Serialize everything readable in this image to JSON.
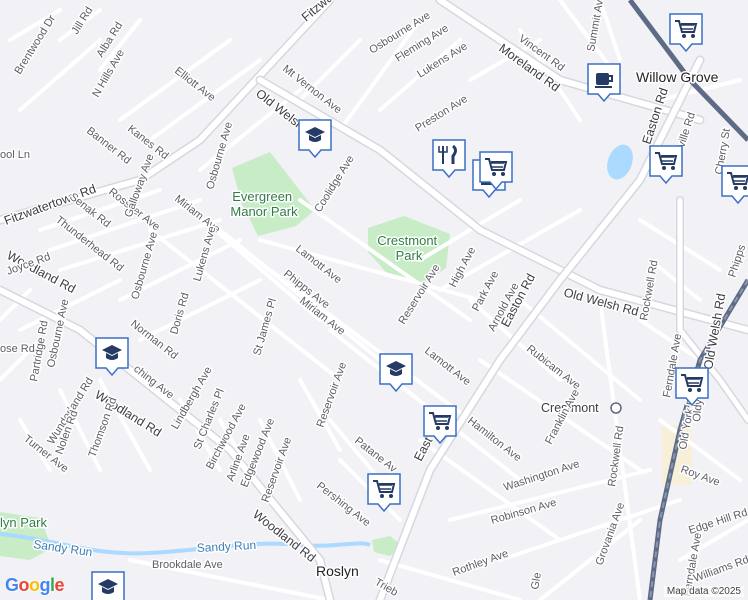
{
  "colors": {
    "background": "#f2f1f5",
    "road": "#ffffff",
    "road_casing": "#cfd2da",
    "major_road": "#ffffff",
    "highway": "#8b97ad",
    "rail": "#5d6b86",
    "park": "#c7ecc6",
    "water": "#aadaff",
    "pin_fill": "#ffffff",
    "pin_border": "#3a6fc4",
    "pin_icon": "#253a64",
    "place_tint": "#fcefc4"
  },
  "parks": {
    "evergreen": "Evergreen\nManor Park",
    "crestmont": "Crestmont\nPark",
    "sandy_run_park": "lyn Park"
  },
  "water": {
    "sandy_run_1": "Sandy Run",
    "sandy_run_2": "Sandy Run"
  },
  "places": {
    "willow_grove": "Willow Grove",
    "roslyn": "Roslyn",
    "crestmont": "Crestmont"
  },
  "streets": {
    "fitzwatertown_top": "Fitzwatertown Rd",
    "fitzwatertown_left": "Fitzwatertown Rd",
    "moreland": "Moreland Rd",
    "old_welsh_top": "Old Welsh Rd",
    "old_welsh_mid": "Old Welsh Rd",
    "old_welsh_right": "Old Welsh Rd",
    "woodland_left": "Woodland Rd",
    "woodland_mid": "Woodland Rd",
    "woodland_bottom": "Woodland Rd",
    "easton_top": "Easton Rd",
    "easton_mid": "Easton Rd",
    "easton_low": "East",
    "brentwood": "Brentwood Dr",
    "jill": "Jill Rd",
    "alba": "Alba Rd",
    "n_hills": "N Hills Ave",
    "elliott": "Elliott Ave",
    "mt_vernon": "Mt Vernon Ave",
    "osbourne_top": "Osbourne Ave",
    "fleming": "Fleming Ave",
    "lukens_top": "Lukens Ave",
    "vincent": "Vincent Rd",
    "summit": "Summit Ave",
    "preston": "Preston Ave",
    "banner": "Banner Rd",
    "kanes": "Kanes Rd",
    "osbourne_mid": "Osbourne Ave",
    "coolidge": "Coolidge Ave",
    "rossiter": "Rossiter Ave",
    "galloway": "Galloway Ave",
    "miriam_top": "Miriam Ave",
    "senak": "Senak Rd",
    "thunderhead": "Thunderhead Rd",
    "osbourne_low": "Osbourne Ave",
    "lukens_mid": "Lukens Ave",
    "lamott_top": "Lamott Ave",
    "phipps": "Phipps Ave",
    "joyce": "Joyce Rd",
    "ool": "ool Ln",
    "high": "High Ave",
    "park_ave": "Park Ave",
    "reservoir_top": "Reservoir Ave",
    "arnold": "Arnold Ave",
    "rockwell_top": "Rockwell Rd",
    "cherry": "Cherry St",
    "ville": "ville Rd",
    "phipps_right": "Phipps",
    "norman": "Norman Rd",
    "doris": "Doris Rd",
    "partridge": "Partridge Rd",
    "osbourne_left": "Osbourne Ave",
    "rose": "ose Rd",
    "st_james": "St James Pl",
    "miriam_low": "Miriam Ave",
    "lamott_low": "Lamott Ave",
    "rubicam": "Rubicam Ave",
    "ching": "ching Ave",
    "lindbergh": "Lindbergh Ave",
    "wunderland": "Wunderland Rd",
    "thomson": "Thomson Rd",
    "st_charles": "St Charles Pl",
    "birchwood": "Birchwood Ave",
    "reservoir_low": "Reservoir Ave",
    "turner": "Turner Ave",
    "nolen": "Nolen Rd",
    "arline": "Arline Ave",
    "edgewood": "Edgewood Ave",
    "reservoir_bottom": "Reservoir Ave",
    "patane": "Patane Av",
    "hamilton": "Hamilton Ave",
    "franklin": "Franklin Ave",
    "rockwell_low": "Rockwell Rd",
    "ferndale_top": "Ferndale Ave",
    "old_york": "Old York Rd",
    "oldy": "Oldy",
    "roy": "Roy Ave",
    "washington": "Washington Ave",
    "robinson": "Robinson Ave",
    "pershing": "Pershing Ave",
    "grovania": "Grovania Ave",
    "ferndale_low": "Ferndale Ave",
    "edge_hill": "Edge Hill Rd",
    "williams": "Williams Rd",
    "brookdale": "Brookdale Ave",
    "rothley": "Rothley Ave",
    "trieb": "Trieb",
    "gle": "Gle"
  },
  "pins": [
    {
      "type": "school",
      "icon": "graduation-cap"
    },
    {
      "type": "school",
      "icon": "graduation-cap"
    },
    {
      "type": "school",
      "icon": "graduation-cap"
    },
    {
      "type": "school",
      "icon": "graduation-cap"
    },
    {
      "type": "restaurant",
      "icon": "fork-knife"
    },
    {
      "type": "shopping",
      "icon": "shopping-bag"
    },
    {
      "type": "cafe",
      "icon": "coffee-cup"
    },
    {
      "type": "grocery",
      "icon": "shopping-cart"
    },
    {
      "type": "grocery",
      "icon": "shopping-cart"
    },
    {
      "type": "grocery",
      "icon": "shopping-cart"
    },
    {
      "type": "grocery",
      "icon": "shopping-cart"
    },
    {
      "type": "grocery",
      "icon": "shopping-cart"
    },
    {
      "type": "grocery",
      "icon": "shopping-cart"
    },
    {
      "type": "grocery",
      "icon": "shopping-cart"
    }
  ],
  "attribution": {
    "logo": "Google",
    "map_data": "Map data ©2025"
  }
}
